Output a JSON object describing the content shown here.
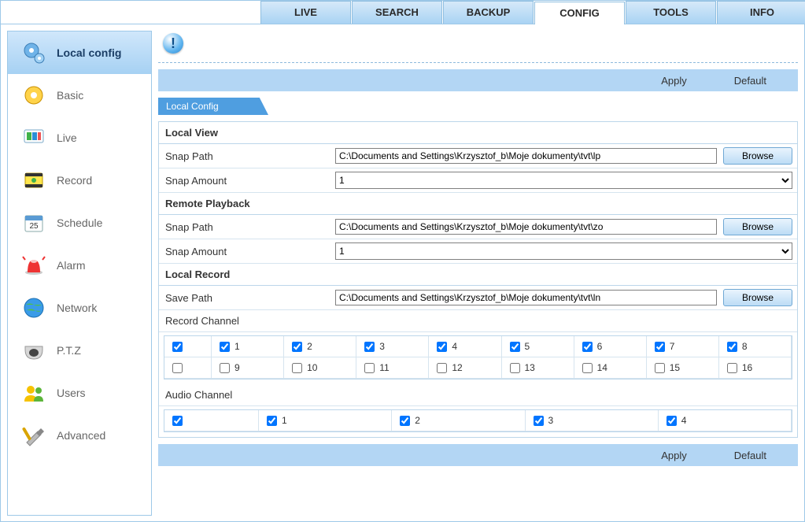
{
  "tabs": {
    "live": "LIVE",
    "search": "SEARCH",
    "backup": "BACKUP",
    "config": "CONFIG",
    "tools": "TOOLS",
    "info": "INFO"
  },
  "sidebar": [
    {
      "key": "localconfig",
      "label": "Local config"
    },
    {
      "key": "basic",
      "label": "Basic"
    },
    {
      "key": "live",
      "label": "Live"
    },
    {
      "key": "record",
      "label": "Record"
    },
    {
      "key": "schedule",
      "label": "Schedule"
    },
    {
      "key": "alarm",
      "label": "Alarm"
    },
    {
      "key": "network",
      "label": "Network"
    },
    {
      "key": "ptz",
      "label": "P.T.Z"
    },
    {
      "key": "users",
      "label": "Users"
    },
    {
      "key": "advanced",
      "label": "Advanced"
    }
  ],
  "actions": {
    "apply": "Apply",
    "default": "Default"
  },
  "ribbon_tab": "Local Config",
  "sections": {
    "local_view": {
      "title": "Local View",
      "snap_path_label": "Snap Path",
      "snap_path_value": "C:\\Documents and Settings\\Krzysztof_b\\Moje dokumenty\\tvt\\lp",
      "snap_amount_label": "Snap Amount",
      "snap_amount_value": "1"
    },
    "remote_playback": {
      "title": "Remote Playback",
      "snap_path_label": "Snap Path",
      "snap_path_value": "C:\\Documents and Settings\\Krzysztof_b\\Moje dokumenty\\tvt\\zo",
      "snap_amount_label": "Snap Amount",
      "snap_amount_value": "1"
    },
    "local_record": {
      "title": "Local Record",
      "save_path_label": "Save Path",
      "save_path_value": "C:\\Documents and Settings\\Krzysztof_b\\Moje dokumenty\\tvt\\ln",
      "record_channel_label": "Record Channel",
      "audio_channel_label": "Audio Channel"
    }
  },
  "browse": "Browse",
  "record_channels": [
    {
      "n": "1",
      "checked": true
    },
    {
      "n": "2",
      "checked": true
    },
    {
      "n": "3",
      "checked": true
    },
    {
      "n": "4",
      "checked": true
    },
    {
      "n": "5",
      "checked": true
    },
    {
      "n": "6",
      "checked": true
    },
    {
      "n": "7",
      "checked": true
    },
    {
      "n": "8",
      "checked": true
    },
    {
      "n": "9",
      "checked": false
    },
    {
      "n": "10",
      "checked": false
    },
    {
      "n": "11",
      "checked": false
    },
    {
      "n": "12",
      "checked": false
    },
    {
      "n": "13",
      "checked": false
    },
    {
      "n": "14",
      "checked": false
    },
    {
      "n": "15",
      "checked": false
    },
    {
      "n": "16",
      "checked": false
    }
  ],
  "record_master_row1": true,
  "record_master_row2": false,
  "audio_master": true,
  "audio_channels": [
    {
      "n": "1",
      "checked": true
    },
    {
      "n": "2",
      "checked": true
    },
    {
      "n": "3",
      "checked": true
    },
    {
      "n": "4",
      "checked": true
    }
  ]
}
